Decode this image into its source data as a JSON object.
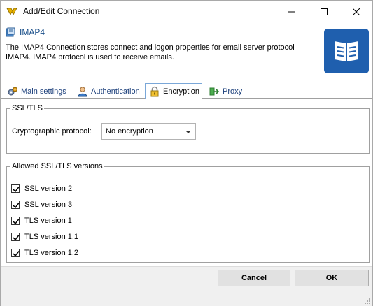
{
  "window": {
    "title": "Add/Edit Connection",
    "icon": "connection-app-icon"
  },
  "header": {
    "title": "IMAP4",
    "description": "The IMAP4 Connection stores connect and logon properties for email server protocol IMAP4. IMAP4 protocol is used to receive emails.",
    "book_icon": "book-icon",
    "accent": "#1f5fae"
  },
  "tabs": [
    {
      "label": "Main settings",
      "icon": "gears-icon",
      "active": false
    },
    {
      "label": "Authentication",
      "icon": "user-icon",
      "active": false
    },
    {
      "label": "Encryption",
      "icon": "lock-icon",
      "active": true
    },
    {
      "label": "Proxy",
      "icon": "proxy-icon",
      "active": false
    }
  ],
  "ssl_group": {
    "title": "SSL/TLS",
    "protocol_label": "Cryptographic protocol:",
    "protocol_value": "No encryption"
  },
  "versions_group": {
    "title": "Allowed SSL/TLS versions",
    "items": [
      {
        "label": "SSL version 2",
        "checked": true
      },
      {
        "label": "SSL version 3",
        "checked": true
      },
      {
        "label": "TLS version 1",
        "checked": true
      },
      {
        "label": "TLS version 1.1",
        "checked": true
      },
      {
        "label": "TLS version 1.2",
        "checked": true
      }
    ]
  },
  "buttons": {
    "cancel": "Cancel",
    "ok": "OK"
  }
}
